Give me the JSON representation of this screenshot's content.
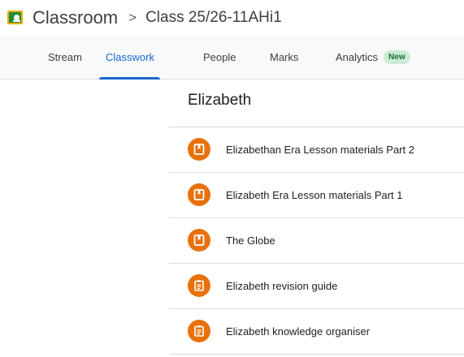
{
  "header": {
    "app_name": "Classroom",
    "separator": ">",
    "class_name": "Class 25/26-11AHi1"
  },
  "tabs": [
    {
      "label": "Stream"
    },
    {
      "label": "Classwork"
    },
    {
      "label": "People"
    },
    {
      "label": "Marks"
    },
    {
      "label": "Analytics",
      "badge": "New"
    }
  ],
  "active_tab": "Classwork",
  "section": {
    "title": "Elizabeth",
    "items": [
      {
        "label": "Elizabethan Era Lesson materials Part 2",
        "icon": "material-icon"
      },
      {
        "label": "Elizabeth Era Lesson materials Part 1",
        "icon": "material-icon"
      },
      {
        "label": "The Globe",
        "icon": "material-icon"
      },
      {
        "label": "Elizabeth revision guide",
        "icon": "assignment-icon"
      },
      {
        "label": "Elizabeth knowledge organiser",
        "icon": "assignment-icon"
      }
    ]
  },
  "colors": {
    "accent": "#1967d2",
    "item_icon_bg": "#e8710a",
    "badge_bg": "#ceead6",
    "badge_text": "#137333"
  }
}
